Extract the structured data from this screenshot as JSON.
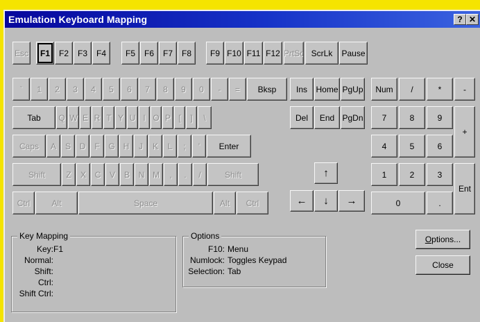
{
  "title": "Emulation Keyboard Mapping",
  "titlebar_buttons": {
    "help": "?",
    "close": "✕"
  },
  "fkeys": [
    {
      "label": "Esc",
      "disabled": true
    },
    {
      "label": "F1",
      "selected": true
    },
    {
      "label": "F2"
    },
    {
      "label": "F3"
    },
    {
      "label": "F4"
    },
    {
      "label": "F5"
    },
    {
      "label": "F6"
    },
    {
      "label": "F7"
    },
    {
      "label": "F8"
    },
    {
      "label": "F9"
    },
    {
      "label": "F10"
    },
    {
      "label": "F11"
    },
    {
      "label": "F12"
    },
    {
      "label": "PrtSc",
      "disabled": true
    },
    {
      "label": "ScrLk"
    },
    {
      "label": "Pause"
    }
  ],
  "main_rows": [
    [
      {
        "label": "`",
        "disabled": true
      },
      {
        "label": "1",
        "disabled": true
      },
      {
        "label": "2",
        "disabled": true
      },
      {
        "label": "3",
        "disabled": true
      },
      {
        "label": "4",
        "disabled": true
      },
      {
        "label": "5",
        "disabled": true
      },
      {
        "label": "6",
        "disabled": true
      },
      {
        "label": "7",
        "disabled": true
      },
      {
        "label": "8",
        "disabled": true
      },
      {
        "label": "9",
        "disabled": true
      },
      {
        "label": "0",
        "disabled": true
      },
      {
        "label": "-",
        "disabled": true
      },
      {
        "label": "=",
        "disabled": true
      },
      {
        "label": "Bksp"
      }
    ],
    [
      {
        "label": "Tab"
      },
      {
        "label": "Q",
        "disabled": true
      },
      {
        "label": "W",
        "disabled": true
      },
      {
        "label": "E",
        "disabled": true
      },
      {
        "label": "R",
        "disabled": true
      },
      {
        "label": "T",
        "disabled": true
      },
      {
        "label": "Y",
        "disabled": true
      },
      {
        "label": "U",
        "disabled": true
      },
      {
        "label": "I",
        "disabled": true
      },
      {
        "label": "O",
        "disabled": true
      },
      {
        "label": "P",
        "disabled": true
      },
      {
        "label": "[",
        "disabled": true
      },
      {
        "label": "]",
        "disabled": true
      },
      {
        "label": "\\",
        "disabled": true
      }
    ],
    [
      {
        "label": "Caps",
        "disabled": true
      },
      {
        "label": "A",
        "disabled": true
      },
      {
        "label": "S",
        "disabled": true
      },
      {
        "label": "D",
        "disabled": true
      },
      {
        "label": "F",
        "disabled": true
      },
      {
        "label": "G",
        "disabled": true
      },
      {
        "label": "H",
        "disabled": true
      },
      {
        "label": "J",
        "disabled": true
      },
      {
        "label": "K",
        "disabled": true
      },
      {
        "label": "L",
        "disabled": true
      },
      {
        "label": ";",
        "disabled": true
      },
      {
        "label": "'",
        "disabled": true
      },
      {
        "label": "Enter"
      }
    ],
    [
      {
        "label": "Shift",
        "disabled": true
      },
      {
        "label": "Z",
        "disabled": true
      },
      {
        "label": "X",
        "disabled": true
      },
      {
        "label": "C",
        "disabled": true
      },
      {
        "label": "V",
        "disabled": true
      },
      {
        "label": "B",
        "disabled": true
      },
      {
        "label": "N",
        "disabled": true
      },
      {
        "label": "M",
        "disabled": true
      },
      {
        "label": ",",
        "disabled": true
      },
      {
        "label": ".",
        "disabled": true
      },
      {
        "label": "/",
        "disabled": true
      },
      {
        "label": "Shift",
        "disabled": true
      }
    ],
    [
      {
        "label": "Ctrl",
        "disabled": true
      },
      {
        "label": "Alt",
        "disabled": true
      },
      {
        "label": "Space",
        "disabled": true
      },
      {
        "label": "Alt",
        "disabled": true
      },
      {
        "label": "Ctrl",
        "disabled": true
      }
    ]
  ],
  "nav_keys": [
    {
      "label": "Ins"
    },
    {
      "label": "Home"
    },
    {
      "label": "PgUp"
    },
    {
      "label": "Del"
    },
    {
      "label": "End"
    },
    {
      "label": "PgDn"
    }
  ],
  "arrow_keys": {
    "up": "↑",
    "left": "←",
    "down": "↓",
    "right": "→"
  },
  "numpad": [
    {
      "label": "Num"
    },
    {
      "label": "/"
    },
    {
      "label": "*"
    },
    {
      "label": "-"
    },
    {
      "label": "7"
    },
    {
      "label": "8"
    },
    {
      "label": "9"
    },
    {
      "label": "+"
    },
    {
      "label": "4"
    },
    {
      "label": "5"
    },
    {
      "label": "6"
    },
    {
      "label": "1"
    },
    {
      "label": "2"
    },
    {
      "label": "3"
    },
    {
      "label": "Ent"
    },
    {
      "label": "0"
    },
    {
      "label": "."
    }
  ],
  "key_mapping": {
    "legend": "Key Mapping",
    "rows": [
      {
        "label": "Key:",
        "value": "F1"
      },
      {
        "label": "Normal:",
        "value": ""
      },
      {
        "label": "Shift:",
        "value": ""
      },
      {
        "label": "Ctrl:",
        "value": ""
      },
      {
        "label": "Shift Ctrl:",
        "value": ""
      }
    ]
  },
  "options_group": {
    "legend": "Options",
    "rows": [
      {
        "label": "F10:",
        "value": "Menu"
      },
      {
        "label": "Numlock:",
        "value": "Toggles Keypad"
      },
      {
        "label": "Selection:",
        "value": "Tab"
      }
    ]
  },
  "buttons": {
    "options_prefix": "",
    "options_mnemonic": "O",
    "options_rest": "ptions...",
    "close": "Close"
  }
}
